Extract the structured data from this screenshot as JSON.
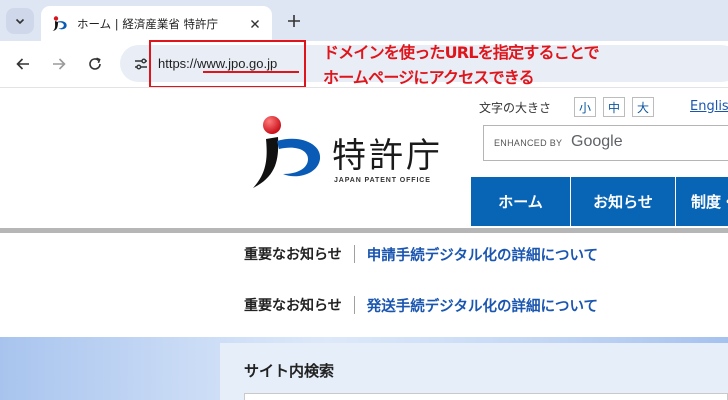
{
  "browser": {
    "tab": {
      "title": "ホーム | 経済産業省 特許庁"
    },
    "address_bar": {
      "url": "https://www.jpo.go.jp"
    }
  },
  "annotation": {
    "lines": [
      "ドメインを使ったURLを指定することで",
      "ホームページにアクセスできる"
    ],
    "color": "#e0151b"
  },
  "site": {
    "logo": {
      "name": "特許庁",
      "subtitle": "JAPAN PATENT OFFICE"
    },
    "font_size": {
      "label": "文字の大きさ",
      "options": [
        "小",
        "中",
        "大"
      ]
    },
    "english_link": "English",
    "search": {
      "enhanced_label": "ENHANCED BY",
      "google_label": "Google"
    },
    "nav": [
      "ホーム",
      "お知らせ",
      "制度・手続"
    ],
    "news": [
      {
        "label": "重要なお知らせ",
        "link": "申請手続デジタル化の詳細について"
      },
      {
        "label": "重要なお知らせ",
        "link": "発送手続デジタル化の詳細について"
      }
    ],
    "site_search_title": "サイト内検索",
    "accent_color": "#0865b6",
    "link_color": "#1a56b0"
  }
}
